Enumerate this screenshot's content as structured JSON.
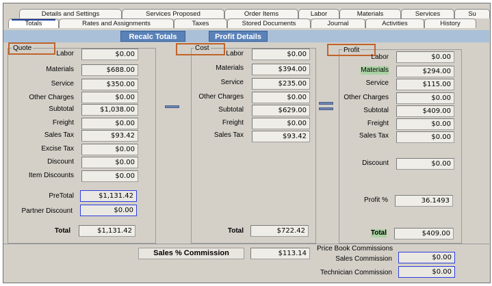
{
  "tabs_back": [
    "Details and Settings",
    "Services Proposed",
    "Order Items",
    "Labor",
    "Materials",
    "Services",
    "Su"
  ],
  "tabs_front": [
    "Totals",
    "Rates and Assignments",
    "Taxes",
    "Stored Documents",
    "Journal",
    "Activities",
    "History"
  ],
  "toolbar": {
    "recalc": "Recalc Totals",
    "profit": "Profit Details"
  },
  "quote": {
    "legend": "Quote",
    "labels": {
      "labor": "Labor",
      "materials": "Materials",
      "service": "Service",
      "other": "Other Charges",
      "subtotal": "Subtotal",
      "freight": "Freight",
      "salestax": "Sales Tax",
      "excise": "Excise Tax",
      "discount": "Discount",
      "itemdisc": "Item Discounts",
      "pretotal": "PreTotal",
      "partner": "Partner Discount",
      "total": "Total"
    },
    "values": {
      "labor": "$0.00",
      "materials": "$688.00",
      "service": "$350.00",
      "other": "$0.00",
      "subtotal": "$1,038.00",
      "freight": "$0.00",
      "salestax": "$93.42",
      "excise": "$0.00",
      "discount": "$0.00",
      "itemdisc": "$0.00",
      "pretotal": "$1,131.42",
      "partner": "$0.00",
      "total": "$1,131.42"
    }
  },
  "cost": {
    "legend": "Cost",
    "labels": {
      "labor": "Labor",
      "materials": "Materials",
      "service": "Service",
      "other": "Other Charges",
      "subtotal": "Subtotal",
      "freight": "Freight",
      "salestax": "Sales Tax",
      "total": "Total"
    },
    "values": {
      "labor": "$0.00",
      "materials": "$394.00",
      "service": "$235.00",
      "other": "$0.00",
      "subtotal": "$629.00",
      "freight": "$0.00",
      "salestax": "$93.42",
      "total": "$722.42"
    }
  },
  "profit": {
    "legend": "Profit",
    "labels": {
      "labor": "Labor",
      "materials": "Materials",
      "service": "Service",
      "other": "Other Charges",
      "subtotal": "Subtotal",
      "freight": "Freight",
      "salestax": "Sales Tax",
      "discount": "Discount",
      "profitpct": "Profit %",
      "total": "Total"
    },
    "values": {
      "labor": "$0.00",
      "materials": "$294.00",
      "service": "$115.00",
      "other": "$0.00",
      "subtotal": "$409.00",
      "freight": "$0.00",
      "salestax": "$0.00",
      "discount": "$0.00",
      "profitpct": "36.1493",
      "total": "$409.00"
    }
  },
  "commission": {
    "sales_pct_label": "Sales % Commission",
    "sales_pct_value": "$113.14",
    "pricebook_title": "Price Book Commissions",
    "sales_label": "Sales Commission",
    "sales_value": "$0.00",
    "tech_label": "Technician Commission",
    "tech_value": "$0.00"
  },
  "colors": {
    "accent": "#1d3f9a",
    "toolbar": "#a9c0d8",
    "button": "#5b82b8",
    "highlight_box": "#c0622a",
    "blue_field_border": "#2d3cdc",
    "green_highlight": "#a9d2a3"
  }
}
